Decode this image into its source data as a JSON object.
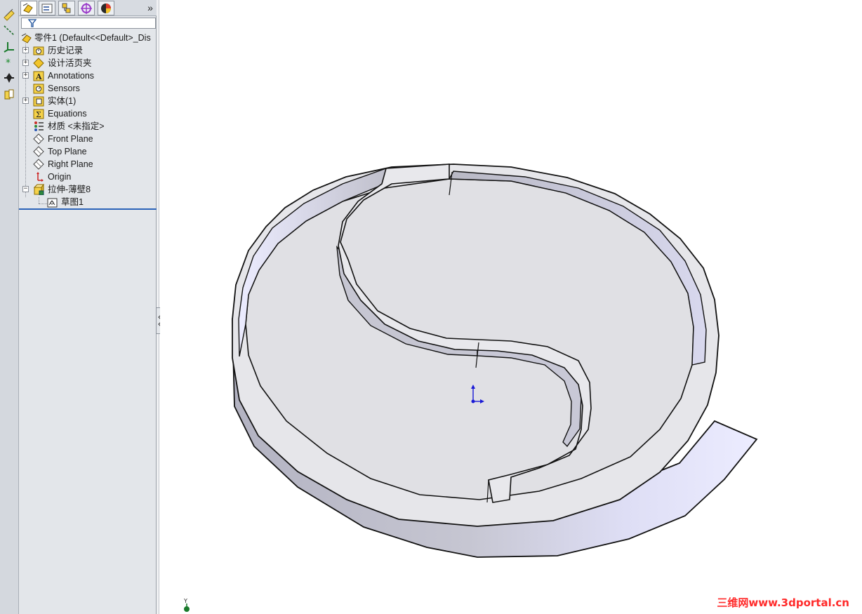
{
  "panel": {
    "tabs": [
      {
        "icon": "feature-manager-icon",
        "active": true
      },
      {
        "icon": "property-manager-icon",
        "active": false
      },
      {
        "icon": "configuration-manager-icon",
        "active": false
      },
      {
        "icon": "dimxpert-manager-icon",
        "active": false
      },
      {
        "icon": "display-manager-icon",
        "active": false
      }
    ],
    "more_glyph": "»"
  },
  "tree": {
    "root": "零件1  (Default<<Default>_Dis",
    "items": [
      {
        "label": "历史记录",
        "icon": "history-folder-icon",
        "expandable": true
      },
      {
        "label": "设计活页夹",
        "icon": "design-binder-icon",
        "expandable": true
      },
      {
        "label": "Annotations",
        "icon": "annotations-icon",
        "expandable": true
      },
      {
        "label": "Sensors",
        "icon": "sensors-icon",
        "expandable": false
      },
      {
        "label": "实体(1)",
        "icon": "solid-bodies-icon",
        "expandable": true
      },
      {
        "label": "Equations",
        "icon": "equations-icon",
        "expandable": false
      },
      {
        "label": "材质 <未指定>",
        "icon": "material-icon",
        "expandable": false
      },
      {
        "label": "Front Plane",
        "icon": "plane-icon",
        "expandable": false
      },
      {
        "label": "Top Plane",
        "icon": "plane-icon",
        "expandable": false
      },
      {
        "label": "Right Plane",
        "icon": "plane-icon",
        "expandable": false
      },
      {
        "label": "Origin",
        "icon": "origin-icon",
        "expandable": false
      },
      {
        "label": "拉伸-薄壁8",
        "icon": "extrude-thin-icon",
        "expandable": true,
        "expanded": true
      },
      {
        "label": "草图1",
        "icon": "sketch-icon",
        "child": true
      }
    ]
  },
  "left_toolbar": [
    "smart-dimension-icon",
    "sketch-line-icon",
    "reference-axes-icon",
    "sketch-point-icon",
    "move-entities-icon",
    "instant3d-icon"
  ],
  "viewport": {
    "watermark": "三维网www.3dportal.cn",
    "triad_axis_label": "Y",
    "model_colors": {
      "face": "#e2e2e6",
      "side_dark": "#b9b9c6",
      "side_light": "#ececff",
      "edge": "#111111"
    }
  }
}
